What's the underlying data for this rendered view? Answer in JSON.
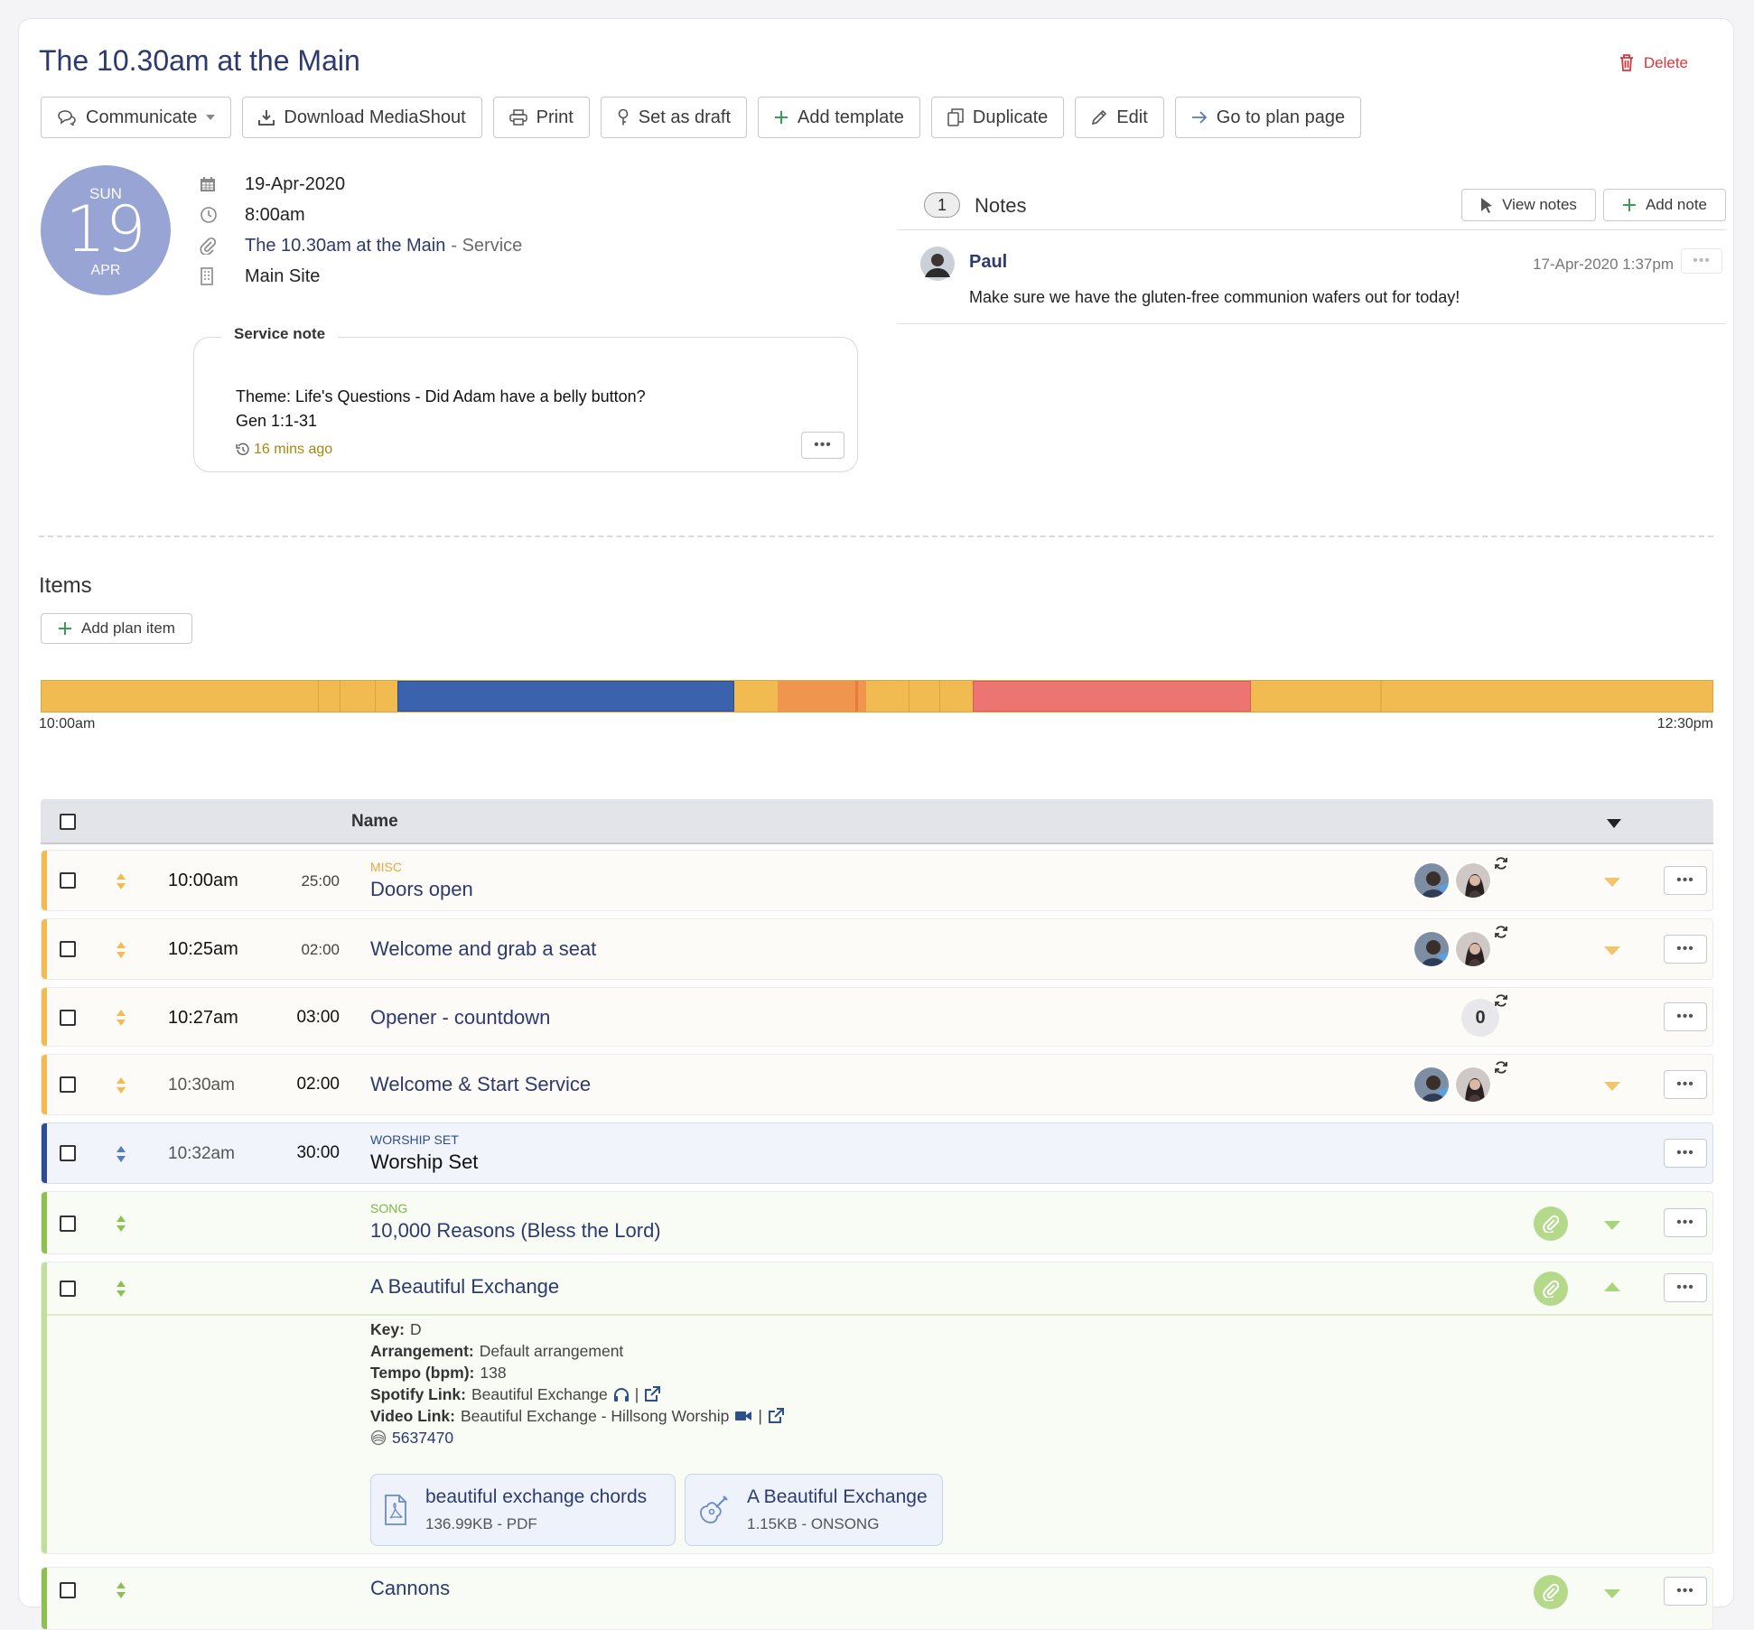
{
  "header": {
    "title": "The 10.30am at the Main",
    "delete_label": "Delete"
  },
  "toolbar": {
    "communicate": "Communicate",
    "download": "Download MediaShout",
    "print": "Print",
    "draft": "Set as draft",
    "add_template": "Add template",
    "duplicate": "Duplicate",
    "edit": "Edit",
    "go_to_plan": "Go to plan page"
  },
  "date_badge": {
    "dow": "SUN",
    "day": "19",
    "month": "APR"
  },
  "meta": {
    "date": "19-Apr-2020",
    "time": "8:00am",
    "plan_link": "The 10.30am at the Main",
    "plan_suffix": "- Service",
    "site": "Main Site"
  },
  "service_note": {
    "label": "Service note",
    "line1": "Theme: Life's Questions - Did Adam have a belly button?",
    "line2": "Gen 1:1-31",
    "time_ago": "16 mins ago"
  },
  "notes": {
    "count": "1",
    "title": "Notes",
    "view_label": "View notes",
    "add_label": "Add note",
    "items": [
      {
        "author": "Paul",
        "time": "17-Apr-2020 1:37pm",
        "text": "Make sure we have the gluten-free communion wafers out for today!"
      }
    ]
  },
  "items_section": {
    "title": "Items",
    "add_label": "Add plan item",
    "timeline_start": "10:00am",
    "timeline_end": "12:30pm",
    "column_name": "Name"
  },
  "colors": {
    "misc": "#f2bb52",
    "worship_set": "#3b63ad",
    "song": "#8cc152",
    "orange": "#f0954e",
    "red": "#ec7471",
    "brand_text": "#2d3a6e"
  },
  "rows": [
    {
      "time": "10:00am",
      "duration": "25:00",
      "category": "MISC",
      "name": "Doors open"
    },
    {
      "time": "10:25am",
      "duration": "02:00",
      "name": "Welcome and grab a seat"
    },
    {
      "time": "10:27am",
      "duration": "03:00",
      "name": "Opener - countdown",
      "count": "0"
    },
    {
      "time": "10:30am",
      "duration": "02:00",
      "name": "Welcome & Start Service"
    },
    {
      "time": "10:32am",
      "duration": "30:00",
      "category": "WORSHIP SET",
      "name": "Worship Set"
    },
    {
      "category": "SONG",
      "name": "10,000 Reasons (Bless the Lord)"
    },
    {
      "name": "A Beautiful Exchange"
    },
    {
      "name": "Cannons"
    }
  ],
  "song_details": {
    "key_label": "Key:",
    "key": "D",
    "arrangement_label": "Arrangement:",
    "arrangement": "Default arrangement",
    "tempo_label": "Tempo (bpm):",
    "tempo": "138",
    "spotify_label": "Spotify Link:",
    "spotify": "Beautiful Exchange",
    "video_label": "Video Link:",
    "video": "Beautiful Exchange - Hillsong Worship",
    "ccli": "5637470",
    "files": [
      {
        "name": "beautiful exchange chords",
        "meta": "136.99KB - PDF",
        "icon": "pdf-file-icon"
      },
      {
        "name": "A Beautiful Exchange",
        "meta": "1.15KB - ONSONG",
        "icon": "guitar-icon"
      }
    ]
  }
}
